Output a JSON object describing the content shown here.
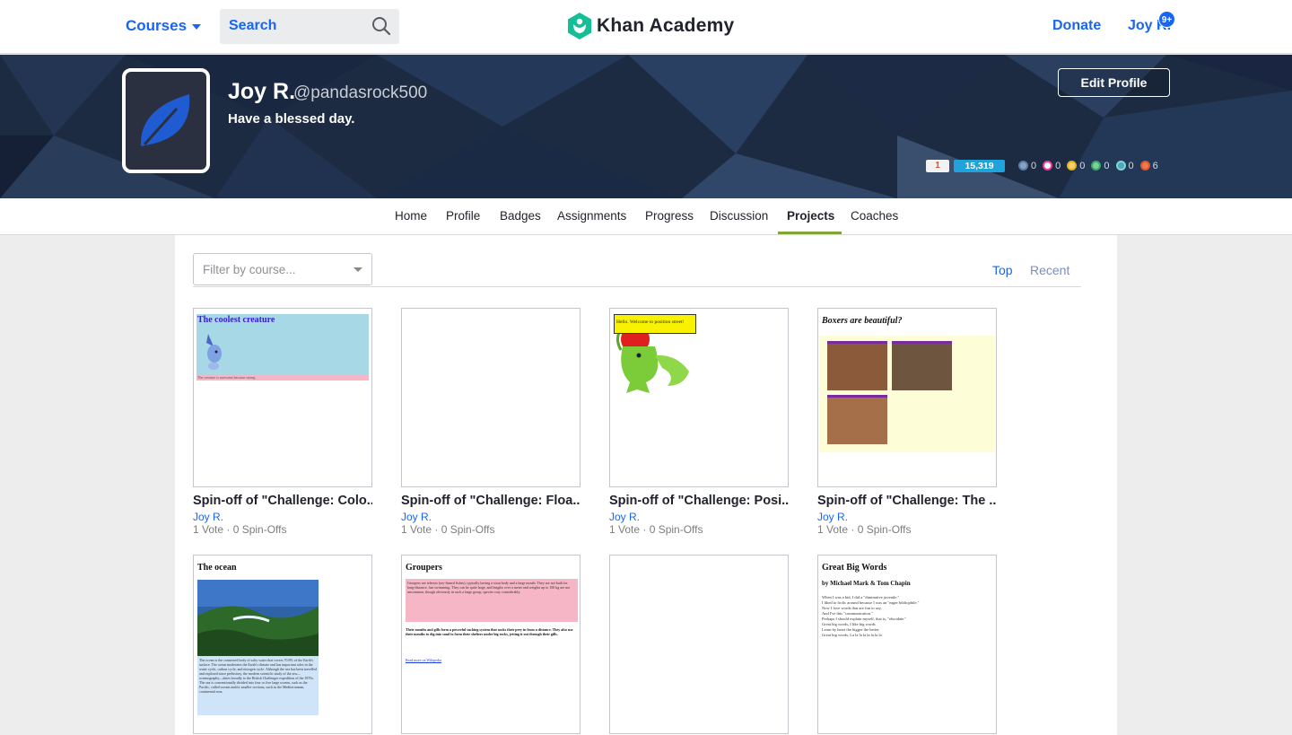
{
  "nav": {
    "courses_label": "Courses",
    "search_placeholder": "Search",
    "logo_text": "Khan Academy",
    "donate_label": "Donate",
    "user_label": "Joy R.",
    "notification_count": "9+"
  },
  "profile": {
    "name": "Joy R.",
    "handle": "@pandasrock500",
    "bio": "Have a blessed day.",
    "edit_label": "Edit Profile",
    "streak": "1",
    "points": "15,319",
    "badges": [
      {
        "icon": "meteorite-badge-icon",
        "count": "0",
        "color": "#5b7fa6"
      },
      {
        "icon": "moon-badge-icon",
        "count": "0",
        "color": "#e93ea6"
      },
      {
        "icon": "earth-badge-icon",
        "count": "0",
        "color": "#e6b417"
      },
      {
        "icon": "sun-badge-icon",
        "count": "0",
        "color": "#3aa76b"
      },
      {
        "icon": "black-hole-badge-icon",
        "count": "0",
        "color": "#7fd4d9"
      },
      {
        "icon": "challenge-patch-icon",
        "count": "6",
        "color": "#e2542c"
      }
    ]
  },
  "tabs": [
    {
      "label": "Home"
    },
    {
      "label": "Profile"
    },
    {
      "label": "Badges"
    },
    {
      "label": "Assignments"
    },
    {
      "label": "Progress"
    },
    {
      "label": "Discussion"
    },
    {
      "label": "Projects"
    },
    {
      "label": "Coaches"
    }
  ],
  "projects": {
    "filter_placeholder": "Filter by course...",
    "sort_top": "Top",
    "sort_recent": "Recent",
    "cards": [
      {
        "title": "Spin-off of \"Challenge: Colo...",
        "author": "Joy R.",
        "meta": "1 Vote · 0 Spin-Offs",
        "thumb_heading": "The coolest creature",
        "thumb_caption": "The creature is awesome because strong."
      },
      {
        "title": "Spin-off of \"Challenge: Floa...",
        "author": "Joy R.",
        "meta": "1 Vote · 0 Spin-Offs"
      },
      {
        "title": "Spin-off of \"Challenge: Posi...",
        "author": "Joy R.",
        "meta": "1 Vote · 0 Spin-Offs",
        "thumb_heading": "Hello. Welcome to position street!"
      },
      {
        "title": "Spin-off of \"Challenge: The ...",
        "author": "Joy R.",
        "meta": "1 Vote · 0 Spin-Offs",
        "thumb_heading": "Boxers are beautiful?"
      },
      {
        "thumb_heading": "The ocean",
        "thumb_caption": "The ocean is the connected body of salty water that covers 70.8% of the Earth's surface. The ocean moderates the Earth's climate and has important roles in the water cycle, carbon cycle, and nitrogen cycle. Although the sea has been travelled and explored since prehistory, the modern scientific study of the sea—oceanography—dates broadly to the British Challenger expedition of the 1870s. The sea is conventionally divided into four or five large oceans, such as the Pacific, called oceans and/or smaller sections, such as the Mediterranean, continental seas."
      },
      {
        "thumb_heading": "Groupers",
        "thumb_caption": "Groupers are teleosts (ray-finned fishes), typically having a stout body and a large mouth. They are not built for long-distance, fast swimming. They can be quite large, and lengths over a meter and weights up to 100 kg are not uncommon, though obviously in such a large group, species vary considerably.",
        "thumb_caption2": "Their mouths and gills form a powerful sucking system that sucks their prey in from a distance. They also use their mouths to dig into sand to form their shelters under big rocks, jetting it out through their gills.",
        "thumb_link": "Read more on Wikipedia"
      },
      {},
      {
        "thumb_heading": "Great Big Words",
        "thumb_sub": "by Michael Mark & Tom Chapin",
        "thumb_lines": [
          "When I was a kid, I did a \"diminutive juvenile.\"",
          "I liked to frolic around because I was an \"eager bibliophile.\"",
          "Now I love words that are fun to say,",
          "And I've this \"communication.\"",
          "Perhaps I should explain myself, that is, \"elucidate.\"",
          "Great big words, I like big words",
          "Learn by heart the bigger the better",
          "Great big words, La la la la la la la la"
        ]
      }
    ]
  }
}
